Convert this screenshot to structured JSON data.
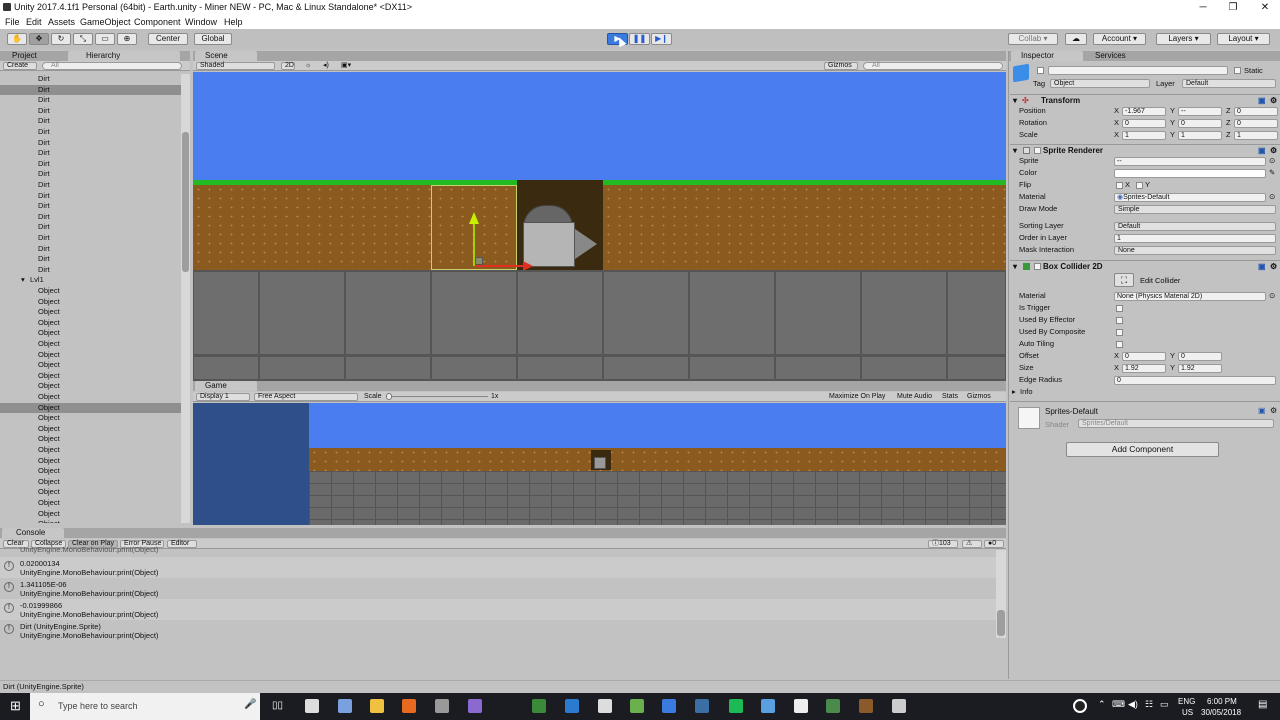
{
  "window": {
    "title": "Unity 2017.4.1f1 Personal (64bit) - Earth.unity - Miner NEW - PC, Mac & Linux Standalone* <DX11>"
  },
  "menu": [
    "File",
    "Edit",
    "Assets",
    "GameObject",
    "Component",
    "Window",
    "Help"
  ],
  "toolbar": {
    "center": "Center",
    "global": "Global",
    "collab": "Collab",
    "account": "Account",
    "layers": "Layers",
    "layout": "Layout"
  },
  "hierarchy": {
    "tab_project": "Project",
    "tab_hierarchy": "Hierarchy",
    "create": "Create",
    "search_placeholder": "All",
    "rows": [
      {
        "label": "Dirt",
        "indent": 1,
        "sel": false
      },
      {
        "label": "Dirt",
        "indent": 1,
        "sel": true
      },
      {
        "label": "Dirt",
        "indent": 1,
        "sel": false
      },
      {
        "label": "Dirt",
        "indent": 1,
        "sel": false
      },
      {
        "label": "Dirt",
        "indent": 1,
        "sel": false
      },
      {
        "label": "Dirt",
        "indent": 1,
        "sel": false
      },
      {
        "label": "Dirt",
        "indent": 1,
        "sel": false
      },
      {
        "label": "Dirt",
        "indent": 1,
        "sel": false
      },
      {
        "label": "Dirt",
        "indent": 1,
        "sel": false
      },
      {
        "label": "Dirt",
        "indent": 1,
        "sel": false
      },
      {
        "label": "Dirt",
        "indent": 1,
        "sel": false
      },
      {
        "label": "Dirt",
        "indent": 1,
        "sel": false
      },
      {
        "label": "Dirt",
        "indent": 1,
        "sel": false
      },
      {
        "label": "Dirt",
        "indent": 1,
        "sel": false
      },
      {
        "label": "Dirt",
        "indent": 1,
        "sel": false
      },
      {
        "label": "Dirt",
        "indent": 1,
        "sel": false
      },
      {
        "label": "Dirt",
        "indent": 1,
        "sel": false
      },
      {
        "label": "Dirt",
        "indent": 1,
        "sel": false
      },
      {
        "label": "Dirt",
        "indent": 1,
        "sel": false
      },
      {
        "label": "Lvl1",
        "indent": 0,
        "sel": false
      },
      {
        "label": "Object",
        "indent": 2,
        "sel": false
      },
      {
        "label": "Object",
        "indent": 2,
        "sel": false
      },
      {
        "label": "Object",
        "indent": 2,
        "sel": false
      },
      {
        "label": "Object",
        "indent": 2,
        "sel": false
      },
      {
        "label": "Object",
        "indent": 2,
        "sel": false
      },
      {
        "label": "Object",
        "indent": 2,
        "sel": false
      },
      {
        "label": "Object",
        "indent": 2,
        "sel": false
      },
      {
        "label": "Object",
        "indent": 2,
        "sel": false
      },
      {
        "label": "Object",
        "indent": 2,
        "sel": false
      },
      {
        "label": "Object",
        "indent": 2,
        "sel": false
      },
      {
        "label": "Object",
        "indent": 2,
        "sel": false
      },
      {
        "label": "Object",
        "indent": 2,
        "sel": true
      },
      {
        "label": "Object",
        "indent": 2,
        "sel": false
      },
      {
        "label": "Object",
        "indent": 2,
        "sel": false
      },
      {
        "label": "Object",
        "indent": 2,
        "sel": false
      },
      {
        "label": "Object",
        "indent": 2,
        "sel": false
      },
      {
        "label": "Object",
        "indent": 2,
        "sel": false
      },
      {
        "label": "Object",
        "indent": 2,
        "sel": false
      },
      {
        "label": "Object",
        "indent": 2,
        "sel": false
      },
      {
        "label": "Object",
        "indent": 2,
        "sel": false
      },
      {
        "label": "Object",
        "indent": 2,
        "sel": false
      },
      {
        "label": "Object",
        "indent": 2,
        "sel": false
      },
      {
        "label": "Object",
        "indent": 2,
        "sel": false
      },
      {
        "label": "Object",
        "indent": 2,
        "sel": false
      }
    ]
  },
  "scene": {
    "tab": "Scene",
    "shading": "Shaded",
    "mode2d": "2D",
    "gizmos": "Gizmos",
    "search_placeholder": "All"
  },
  "game": {
    "tab": "Game",
    "display": "Display 1",
    "aspect": "Free Aspect",
    "scale_label": "Scale",
    "scale_value": "1x",
    "maximize": "Maximize On Play",
    "mute": "Mute Audio",
    "stats": "Stats",
    "gizmos": "Gizmos"
  },
  "inspector": {
    "tab_inspector": "Inspector",
    "tab_services": "Services",
    "static_label": "Static",
    "tag_label": "Tag",
    "tag_value": "Object",
    "layer_label": "Layer",
    "layer_value": "Default",
    "transform": {
      "title": "Transform",
      "position": "Position",
      "rotation": "Rotation",
      "scale": "Scale",
      "pos": [
        "-1.967",
        "--",
        "0"
      ],
      "rot": [
        "0",
        "0",
        "0"
      ],
      "scl": [
        "1",
        "1",
        "1"
      ]
    },
    "sprite_renderer": {
      "title": "Sprite Renderer",
      "sprite": "Sprite",
      "sprite_value": "--",
      "color": "Color",
      "flip": "Flip",
      "flip_x": "X",
      "flip_y": "Y",
      "material": "Material",
      "material_value": "Sprites-Default",
      "draw_mode": "Draw Mode",
      "draw_mode_value": "Simple",
      "sorting_layer": "Sorting Layer",
      "sorting_layer_value": "Default",
      "order_in_layer": "Order in Layer",
      "order_value": "1",
      "mask_interaction": "Mask Interaction",
      "mask_value": "None"
    },
    "box_collider": {
      "title": "Box Collider 2D",
      "edit_collider": "Edit Collider",
      "material": "Material",
      "material_value": "None (Physics Material 2D)",
      "is_trigger": "Is Trigger",
      "used_by_effector": "Used By Effector",
      "used_by_composite": "Used By Composite",
      "auto_tiling": "Auto Tiling",
      "offset": "Offset",
      "offset_x": "0",
      "offset_y": "0",
      "size": "Size",
      "size_x": "1.92",
      "size_y": "1.92",
      "edge_radius": "Edge Radius",
      "edge_radius_value": "0",
      "info": "Info"
    },
    "material_section": {
      "name": "Sprites-Default",
      "shader_label": "Shader",
      "shader_value": "Sprites/Default"
    },
    "add_component": "Add Component",
    "axis": {
      "x": "X",
      "y": "Y",
      "z": "Z"
    }
  },
  "console": {
    "tab": "Console",
    "clear": "Clear",
    "collapse": "Collapse",
    "clear_on_play": "Clear on Play",
    "error_pause": "Error Pause",
    "editor": "Editor",
    "count_logs": "103",
    "count_errors": "0",
    "top_cut": "UnityEngine.MonoBehaviour:print(Object)",
    "entries": [
      {
        "line1": "0.02000134",
        "line2": "UnityEngine.MonoBehaviour:print(Object)"
      },
      {
        "line1": "1.341105E-06",
        "line2": "UnityEngine.MonoBehaviour:print(Object)"
      },
      {
        "line1": "-0.01999866",
        "line2": "UnityEngine.MonoBehaviour:print(Object)"
      },
      {
        "line1": "Dirt (UnityEngine.Sprite)",
        "line2": "UnityEngine.MonoBehaviour:print(Object)"
      }
    ],
    "status": "Dirt (UnityEngine.Sprite)"
  },
  "taskbar": {
    "search_placeholder": "Type here to search",
    "lang": "ENG",
    "region": "US",
    "time": "6:00 PM",
    "date": "30/05/2018"
  },
  "colors": {
    "sky": "#4a7ef0",
    "grass": "#22bb22",
    "dirt": "#8b5a1e",
    "stone": "#6e6e6e",
    "editor_bg": "#c2c2c2",
    "play_accent": "#3a7be0"
  }
}
